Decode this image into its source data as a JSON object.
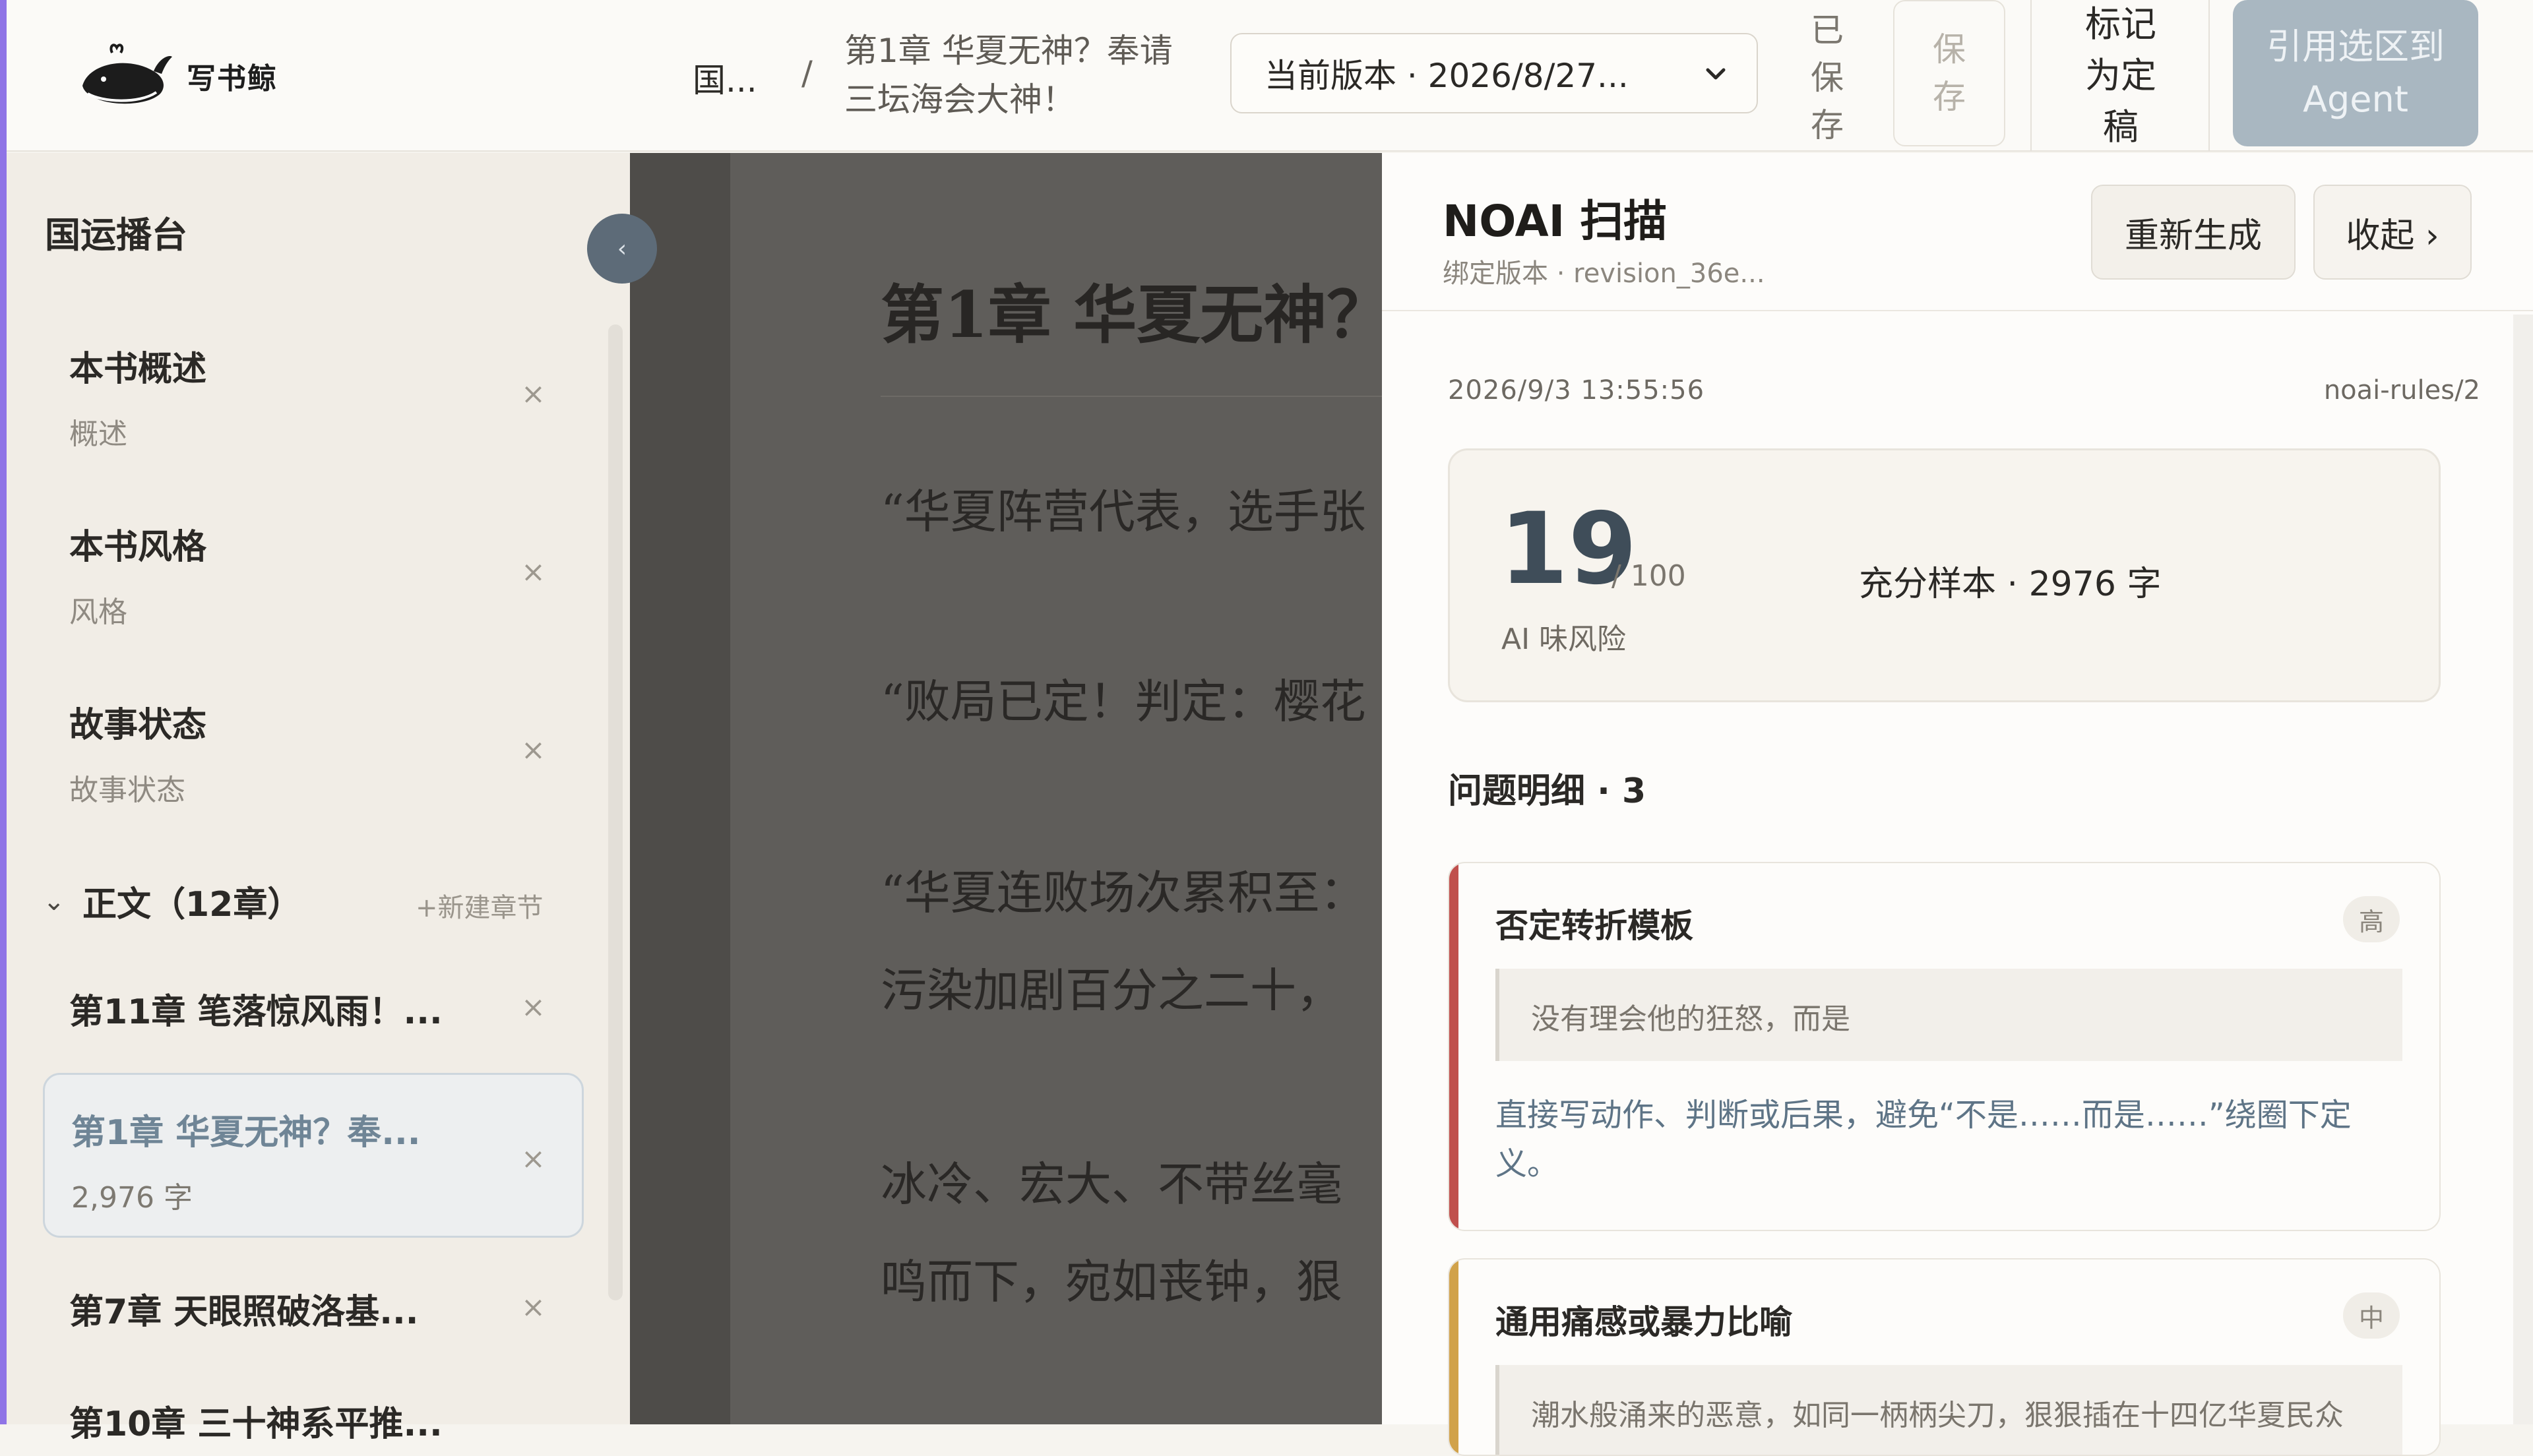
{
  "colors": {
    "accent_purple": "#8f74e6",
    "agent_button": "#a9b7c1",
    "high_severity": "#c0504d",
    "medium_severity": "#d1a24a",
    "advice_text": "#5e7486"
  },
  "app": {
    "name": "写书鲸",
    "logo_icon": "whale-icon"
  },
  "topbar": {
    "breadcrumb_root": "国...",
    "breadcrumb_sep": "/",
    "breadcrumb_title": "第1章 华夏无神？奉请三坛海会大神！",
    "version_select": "当前版本 · 2026/8/27...",
    "saved_status": "已保存",
    "save_label": "保存",
    "mark_final_label": "标记为定稿",
    "cite_agent_label": "引用选区到 Agent"
  },
  "sidebar": {
    "title": "国运播台",
    "items": [
      {
        "title": "本书概述",
        "subtitle": "概述"
      },
      {
        "title": "本书风格",
        "subtitle": "风格"
      },
      {
        "title": "故事状态",
        "subtitle": "故事状态"
      }
    ],
    "section_title": "正文（12章）",
    "new_chapter": "+新建章节",
    "chapters": [
      {
        "title": "第11章 笔落惊风雨！..."
      },
      {
        "title": "第1章 华夏无神？奉...",
        "words": "2,976 字",
        "active": true
      },
      {
        "title": "第7章 天眼照破洛基..."
      },
      {
        "title": "第10章 三十神系平推..."
      }
    ],
    "close_glyph": "×",
    "collapse_glyph": "‹"
  },
  "editor": {
    "title": "第1章 华夏无神？",
    "paragraphs": [
      "“华夏阵营代表，选手张",
      "“败局已定！判定：樱花",
      "“华夏连败场次累积至：",
      "污染加剧百分之二十，",
      "冰冷、宏大、不带丝毫",
      "鸣而下，宛如丧钟，狠"
    ]
  },
  "noai": {
    "title": "NOAI 扫描",
    "bound_version": "绑定版本 · revision_36e...",
    "regenerate_label": "重新生成",
    "collapse_label": "收起 ›",
    "timestamp": "2026/9/3 13:55:56",
    "rules": "noai-rules/2",
    "score": "19",
    "score_max": "/ 100",
    "score_label": "AI 味风险",
    "sample": "充分样本 · 2976 字",
    "issues_heading": "问题明细 · 3",
    "issues": [
      {
        "name": "否定转折模板",
        "level": "高",
        "quote": "没有理会他的狂怒，而是",
        "advice": "直接写动作、判断或后果，避免“不是……而是……”绕圈下定义。"
      },
      {
        "name": "通用痛感或暴力比喻",
        "level": "中",
        "quote": "潮水般涌来的恶意，如同一柄柄尖刀，狠狠插在十四亿华夏民众"
      }
    ]
  }
}
